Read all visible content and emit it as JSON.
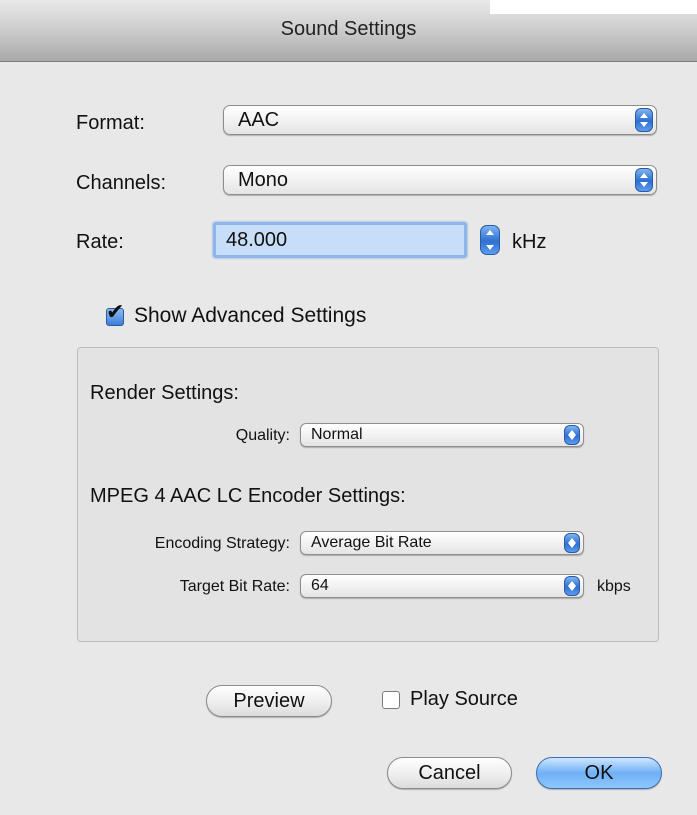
{
  "window": {
    "title": "Sound Settings"
  },
  "format": {
    "label": "Format:",
    "value": "AAC"
  },
  "channels": {
    "label": "Channels:",
    "value": "Mono"
  },
  "rate": {
    "label": "Rate:",
    "value": "48.000",
    "unit": "kHz"
  },
  "advanced": {
    "label": "Show Advanced Settings",
    "checked": true
  },
  "render": {
    "heading": "Render Settings:",
    "quality_label": "Quality:",
    "quality_value": "Normal"
  },
  "encoder": {
    "heading": "MPEG 4 AAC LC Encoder Settings:",
    "strategy_label": "Encoding Strategy:",
    "strategy_value": "Average Bit Rate",
    "bitrate_label": "Target Bit Rate:",
    "bitrate_value": "64",
    "bitrate_unit": "kbps"
  },
  "preview": {
    "button_label": "Preview",
    "play_source_label": "Play Source",
    "play_source_checked": false
  },
  "actions": {
    "cancel_label": "Cancel",
    "ok_label": "OK"
  },
  "colors": {
    "accent": "#3d7fd9",
    "focus_field": "#c8ddf7",
    "window_bg": "#e8e8e8"
  }
}
